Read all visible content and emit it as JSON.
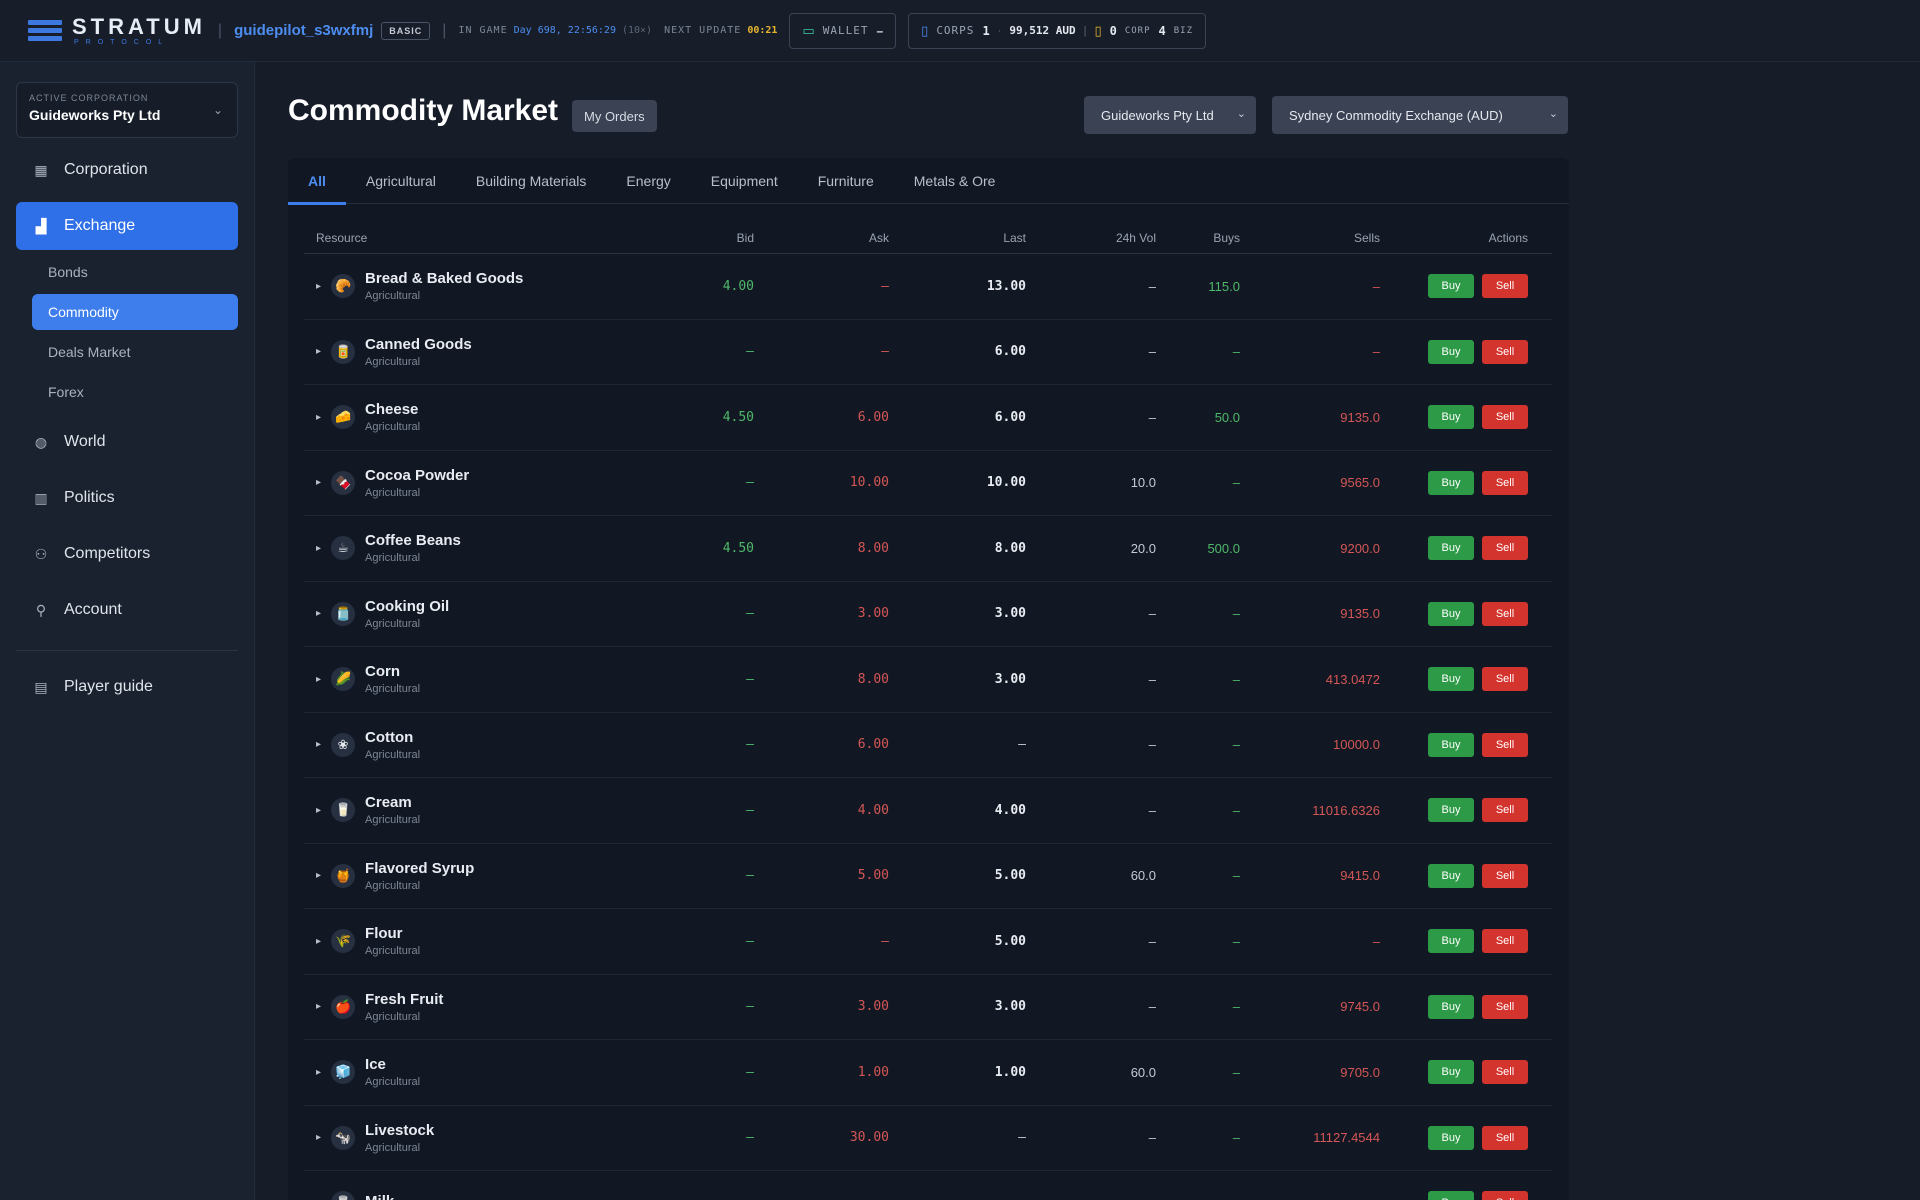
{
  "topbar": {
    "logo_word": "STRATUM",
    "logo_sub": "PROTOCOL",
    "username": "guidepilot_s3wxfmj",
    "plan": "BASIC",
    "in_game_label": "IN GAME",
    "game_time": "Day 698, 22:56:29",
    "game_speed": "(10×)",
    "next_update_label": "NEXT UPDATE",
    "next_update": "00:21",
    "wallet_label": "WALLET",
    "wallet_value": "–",
    "corps_label": "CORPS",
    "corps_count": "1",
    "corps_balance": "99,512 AUD",
    "corp_count": "0",
    "corp_label": "CORP",
    "biz_count": "4",
    "biz_label": "BIZ"
  },
  "sidebar": {
    "active_corp_caption": "ACTIVE CORPORATION",
    "active_corp": "Guideworks Pty Ltd",
    "nav": [
      {
        "label": "Corporation",
        "icon": "building-icon"
      },
      {
        "label": "Exchange",
        "icon": "chart-bars-icon"
      },
      {
        "label": "World",
        "icon": "globe-icon"
      },
      {
        "label": "Politics",
        "icon": "capitol-icon"
      },
      {
        "label": "Competitors",
        "icon": "users-icon"
      },
      {
        "label": "Account",
        "icon": "user-icon"
      },
      {
        "label": "Player guide",
        "icon": "book-icon"
      }
    ],
    "exchange_sub": [
      "Bonds",
      "Commodity",
      "Deals Market",
      "Forex"
    ]
  },
  "main": {
    "title": "Commodity Market",
    "my_orders": "My Orders",
    "corp_select": "Guideworks Pty Ltd",
    "exchange_select": "Sydney Commodity Exchange (AUD)",
    "tabs": [
      "All",
      "Agricultural",
      "Building Materials",
      "Energy",
      "Equipment",
      "Furniture",
      "Metals & Ore"
    ],
    "columns": {
      "resource": "Resource",
      "bid": "Bid",
      "ask": "Ask",
      "last": "Last",
      "vol": "24h Vol",
      "buys": "Buys",
      "sells": "Sells",
      "actions": "Actions"
    },
    "buy_label": "Buy",
    "sell_label": "Sell",
    "rows": [
      {
        "name": "Bread & Baked Goods",
        "category": "Agricultural",
        "bid": "4.00",
        "ask": "–",
        "last": "13.00",
        "vol": "–",
        "buys": "115.0",
        "sells": "–",
        "icon": "🥐"
      },
      {
        "name": "Canned Goods",
        "category": "Agricultural",
        "bid": "–",
        "ask": "–",
        "last": "6.00",
        "vol": "–",
        "buys": "–",
        "sells": "–",
        "icon": "🥫"
      },
      {
        "name": "Cheese",
        "category": "Agricultural",
        "bid": "4.50",
        "ask": "6.00",
        "last": "6.00",
        "vol": "–",
        "buys": "50.0",
        "sells": "9135.0",
        "icon": "🧀"
      },
      {
        "name": "Cocoa Powder",
        "category": "Agricultural",
        "bid": "–",
        "ask": "10.00",
        "last": "10.00",
        "vol": "10.0",
        "buys": "–",
        "sells": "9565.0",
        "icon": "🍫"
      },
      {
        "name": "Coffee Beans",
        "category": "Agricultural",
        "bid": "4.50",
        "ask": "8.00",
        "last": "8.00",
        "vol": "20.0",
        "buys": "500.0",
        "sells": "9200.0",
        "icon": "☕"
      },
      {
        "name": "Cooking Oil",
        "category": "Agricultural",
        "bid": "–",
        "ask": "3.00",
        "last": "3.00",
        "vol": "–",
        "buys": "–",
        "sells": "9135.0",
        "icon": "🫙"
      },
      {
        "name": "Corn",
        "category": "Agricultural",
        "bid": "–",
        "ask": "8.00",
        "last": "3.00",
        "vol": "–",
        "buys": "–",
        "sells": "413.0472",
        "icon": "🌽"
      },
      {
        "name": "Cotton",
        "category": "Agricultural",
        "bid": "–",
        "ask": "6.00",
        "last": "–",
        "vol": "–",
        "buys": "–",
        "sells": "10000.0",
        "icon": "❀"
      },
      {
        "name": "Cream",
        "category": "Agricultural",
        "bid": "–",
        "ask": "4.00",
        "last": "4.00",
        "vol": "–",
        "buys": "–",
        "sells": "11016.6326",
        "icon": "🥛"
      },
      {
        "name": "Flavored Syrup",
        "category": "Agricultural",
        "bid": "–",
        "ask": "5.00",
        "last": "5.00",
        "vol": "60.0",
        "buys": "–",
        "sells": "9415.0",
        "icon": "🍯"
      },
      {
        "name": "Flour",
        "category": "Agricultural",
        "bid": "–",
        "ask": "–",
        "last": "5.00",
        "vol": "–",
        "buys": "–",
        "sells": "–",
        "icon": "🌾"
      },
      {
        "name": "Fresh Fruit",
        "category": "Agricultural",
        "bid": "–",
        "ask": "3.00",
        "last": "3.00",
        "vol": "–",
        "buys": "–",
        "sells": "9745.0",
        "icon": "🍎"
      },
      {
        "name": "Ice",
        "category": "Agricultural",
        "bid": "–",
        "ask": "1.00",
        "last": "1.00",
        "vol": "60.0",
        "buys": "–",
        "sells": "9705.0",
        "icon": "🧊"
      },
      {
        "name": "Livestock",
        "category": "Agricultural",
        "bid": "–",
        "ask": "30.00",
        "last": "–",
        "vol": "–",
        "buys": "–",
        "sells": "11127.4544",
        "icon": "🐄"
      },
      {
        "name": "Milk",
        "category": "",
        "bid": "",
        "ask": "",
        "last": "",
        "vol": "",
        "buys": "",
        "sells": "",
        "icon": "🥛"
      }
    ]
  }
}
